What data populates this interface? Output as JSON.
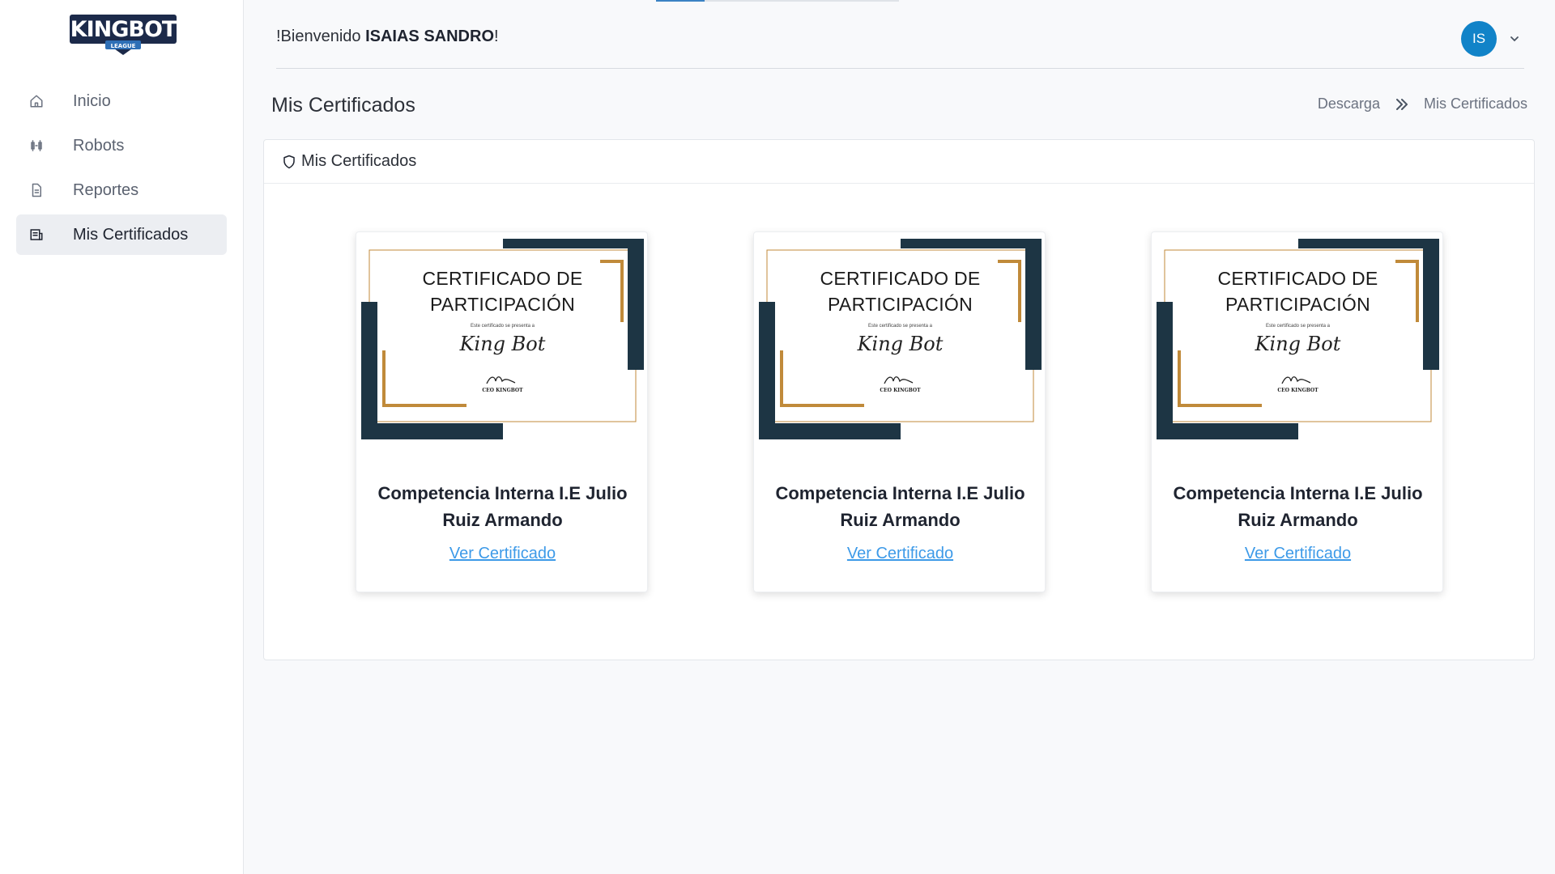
{
  "brand": {
    "logo_text_main": "KINGBOT",
    "logo_text_sub": "LEAGUE"
  },
  "sidebar": {
    "items": [
      {
        "label": "Inicio",
        "icon": "home-icon"
      },
      {
        "label": "Robots",
        "icon": "robot-icon"
      },
      {
        "label": "Reportes",
        "icon": "report-icon"
      },
      {
        "label": "Mis Certificados",
        "icon": "certificate-icon",
        "active": true
      }
    ]
  },
  "header": {
    "welcome_prefix": "!Bienvenido",
    "user_name": "ISAIAS SANDRO",
    "welcome_suffix": "!",
    "avatar_initials": "IS",
    "avatar_color": "#1183c8"
  },
  "page": {
    "title": "Mis Certificados",
    "breadcrumb": [
      "Descarga",
      "Mis Certificados"
    ]
  },
  "panel": {
    "header": "Mis Certificados",
    "icon": "shield-icon"
  },
  "certificate_image": {
    "title_line1": "CERTIFICADO DE",
    "title_line2": "PARTICIPACIÓN",
    "subtitle": "Este certificado se presenta a",
    "script_name": "King Bot",
    "signature_label": "CEO KINGBOT",
    "navy_color": "#1d3544",
    "gold_color": "#c08a3a"
  },
  "certificates": [
    {
      "title": "Competencia Interna I.E Julio Ruiz Armando",
      "link_label": "Ver Certificado"
    },
    {
      "title": "Competencia Interna I.E Julio Ruiz Armando",
      "link_label": "Ver Certificado"
    },
    {
      "title": "Competencia Interna I.E Julio Ruiz Armando",
      "link_label": "Ver Certificado"
    }
  ]
}
